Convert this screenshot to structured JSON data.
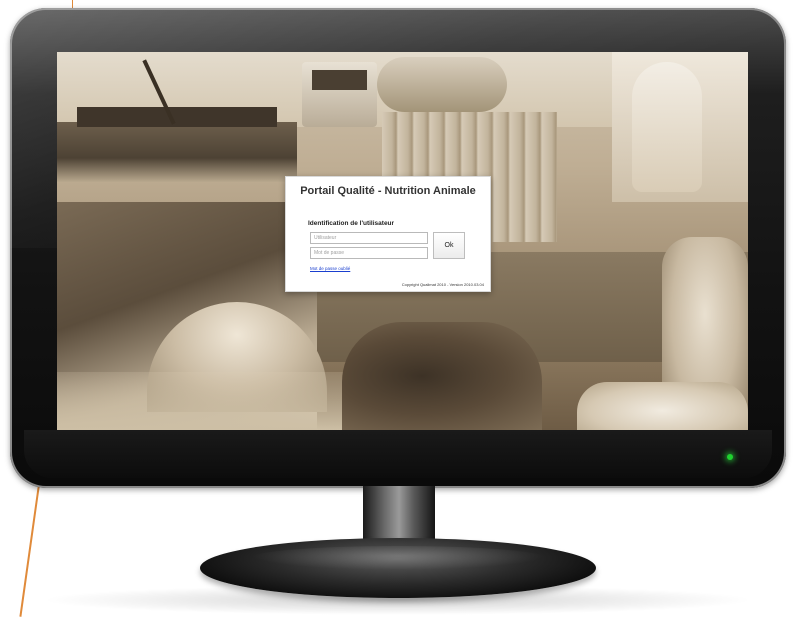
{
  "login": {
    "title": "Portail Qualité - Nutrition Animale",
    "subtitle": "Identification de l'utilisateur",
    "username_placeholder": "Utilisateur",
    "password_placeholder": "Mot de passe",
    "ok_label": "Ok",
    "forgot_link": "Mot de passe oublié",
    "copyright": "Copyright Qualimat 2010 - Version 2010.03.04"
  },
  "colors": {
    "link": "#1a3fcf",
    "power_led": "#1fd12f",
    "screen_tone": "sepia"
  },
  "icons": [
    "power-led-icon"
  ]
}
